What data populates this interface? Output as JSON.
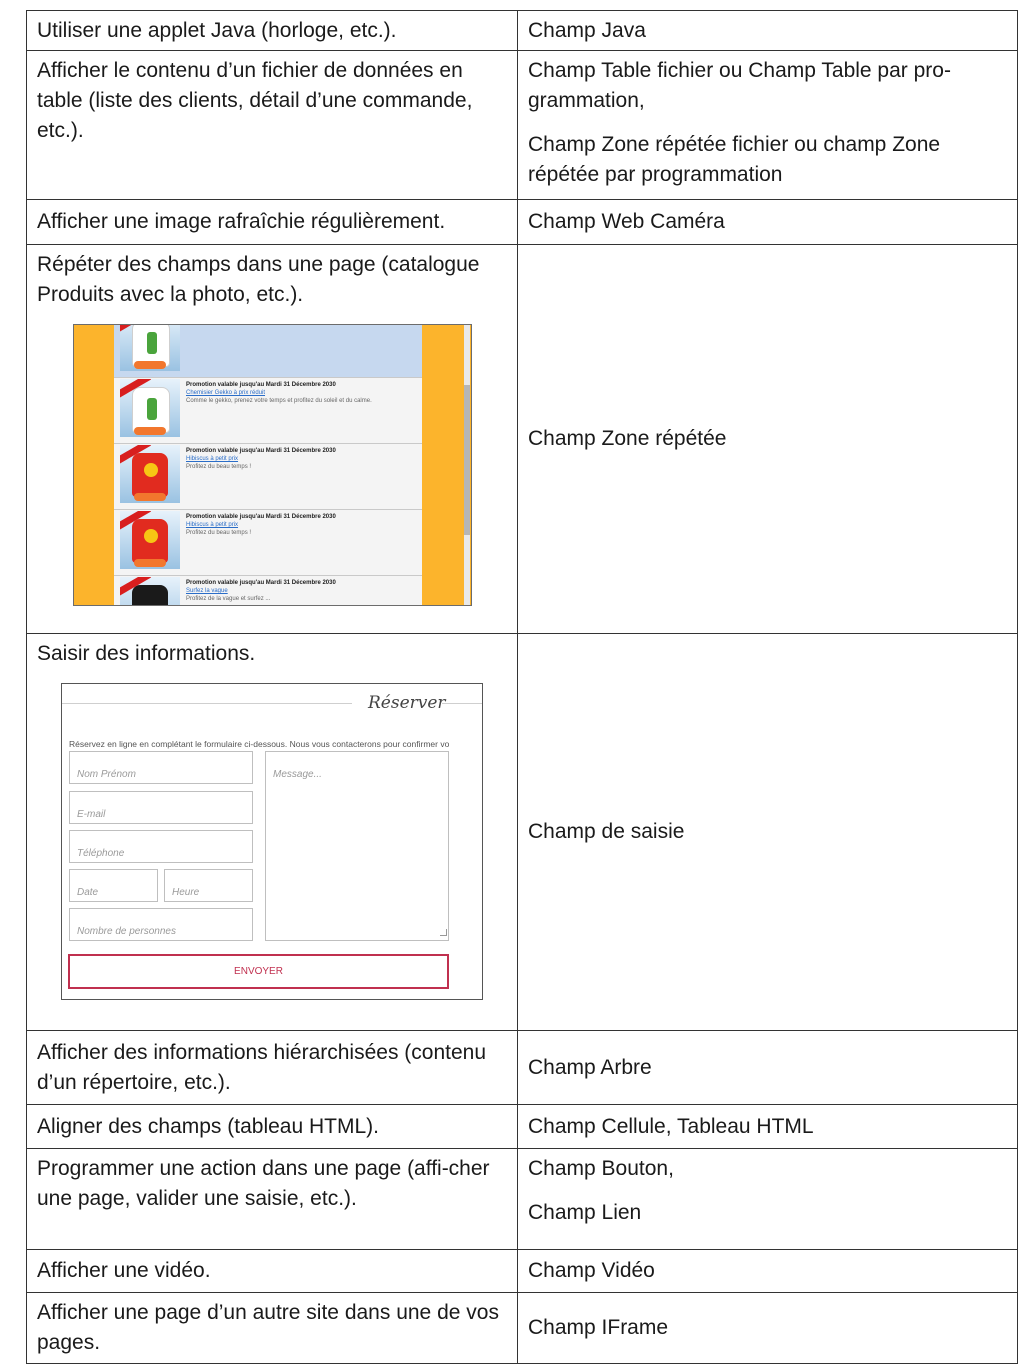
{
  "rows": [
    {
      "use": "Utiliser une applet Java (horloge, etc.).",
      "field": "Champ Java"
    },
    {
      "use": "Afficher le contenu d’un fichier de données en table (liste des clients, détail d’une commande, etc.).",
      "field": "Champ Table fichier ou Champ Table par pro-grammation,",
      "field2": "Champ Zone répétée fichier ou champ Zone répétée par programmation"
    },
    {
      "use": "Afficher une image rafraîchie régulièrement.",
      "field": "Champ Web Caméra"
    },
    {
      "use": "Répéter des champs dans une page (catalogue Produits avec la photo, etc.).",
      "field": "Champ Zone répétée"
    },
    {
      "use": "Saisir des informations.",
      "field": "Champ de saisie"
    },
    {
      "use": "Afficher des informations hiérarchisées (contenu d’un répertoire, etc.).",
      "field": "Champ Arbre"
    },
    {
      "use": "Aligner des champs (tableau HTML).",
      "field": "Champ Cellule, Tableau HTML"
    },
    {
      "use": "Programmer une action dans une page (affi-cher une page, valider une saisie, etc.).",
      "field": "Champ Bouton,",
      "field2": "Champ Lien"
    },
    {
      "use": "Afficher une vidéo.",
      "field": "Champ Vidéo"
    },
    {
      "use": "Afficher une page d’un autre site dans une de vos pages.",
      "field": "Champ IFrame"
    }
  ],
  "catalogue": {
    "items": [
      {
        "promo": "",
        "link": "",
        "desc": "Comme le gekko, prenez votre temps et profitez du soleil et du calme.",
        "shirt": "white",
        "motif": "green"
      },
      {
        "promo": "Promotion valable jusqu'au Mardi 31 Décembre 2030",
        "link": "Chemisier Gekko à prix réduit",
        "desc": "Comme le gekko, prenez votre temps et profitez du soleil et du calme.",
        "shirt": "white",
        "motif": "green"
      },
      {
        "promo": "Promotion valable jusqu'au Mardi 31 Décembre 2030",
        "link": "Hibiscus à petit prix",
        "desc": "Profitez du beau temps !",
        "shirt": "red",
        "motif": "yellow"
      },
      {
        "promo": "Promotion valable jusqu'au Mardi 31 Décembre 2030",
        "link": "Hibiscus à petit prix",
        "desc": "Profitez du beau temps !",
        "shirt": "red",
        "motif": "yellow"
      },
      {
        "promo": "Promotion valable jusqu'au Mardi 31 Décembre 2030",
        "link": "Surfez la vague",
        "desc": "Profitez de la vague et surfez ...",
        "shirt": "dark",
        "motif": "none"
      }
    ]
  },
  "form": {
    "title": "Réserver",
    "intro": "Réservez en ligne en complétant le formulaire ci-dessous. Nous vous contacterons pour confirmer vo",
    "name_placeholder": "Nom Prénom",
    "email_placeholder": "E-mail",
    "phone_placeholder": "Téléphone",
    "date_placeholder": "Date",
    "time_placeholder": "Heure",
    "people_placeholder": "Nombre de personnes",
    "message_placeholder": "Message...",
    "submit_label": "ENVOYER"
  }
}
